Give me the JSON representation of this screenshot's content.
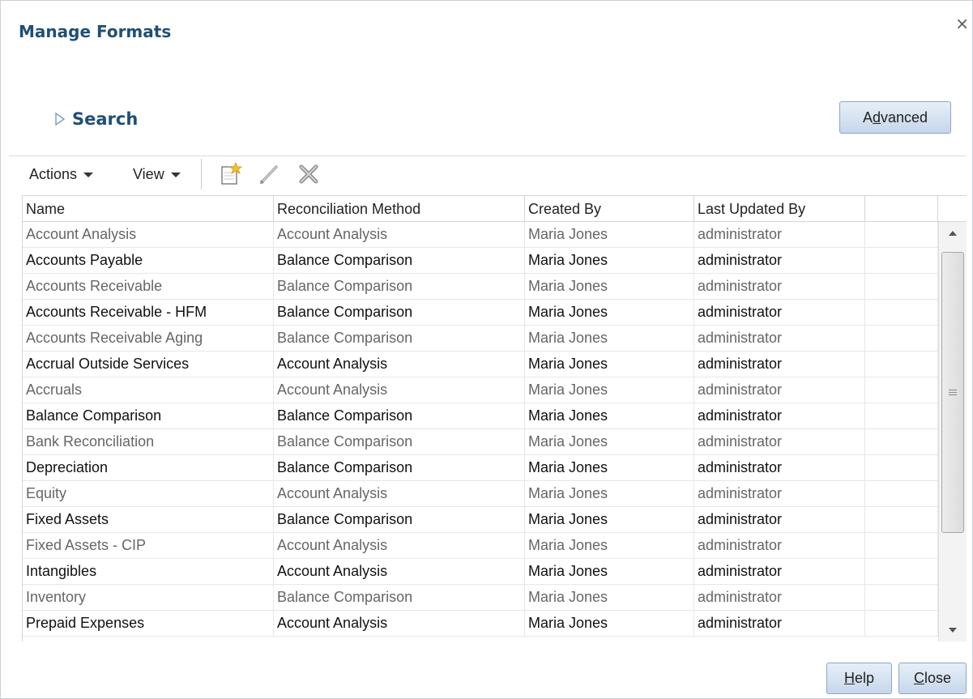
{
  "dialog": {
    "title": "Manage Formats",
    "close_glyph": "×"
  },
  "search": {
    "label": "Search",
    "advanced_pre": "A",
    "advanced_ul": "d",
    "advanced_post": "vanced"
  },
  "toolbar": {
    "actions_label": "Actions",
    "view_label": "View",
    "icons": [
      "new-icon",
      "edit-icon",
      "delete-icon"
    ]
  },
  "table": {
    "columns": [
      "Name",
      "Reconciliation Method",
      "Created By",
      "Last Updated By"
    ],
    "rows": [
      [
        "Account Analysis",
        "Account Analysis",
        "Maria Jones",
        "administrator"
      ],
      [
        "Accounts Payable",
        "Balance Comparison",
        "Maria Jones",
        "administrator"
      ],
      [
        "Accounts Receivable",
        "Balance Comparison",
        "Maria Jones",
        "administrator"
      ],
      [
        "Accounts Receivable - HFM",
        "Balance Comparison",
        "Maria Jones",
        "administrator"
      ],
      [
        "Accounts Receivable Aging",
        "Balance Comparison",
        "Maria Jones",
        "administrator"
      ],
      [
        "Accrual Outside Services",
        "Account Analysis",
        "Maria Jones",
        "administrator"
      ],
      [
        "Accruals",
        "Account Analysis",
        "Maria Jones",
        "administrator"
      ],
      [
        "Balance Comparison",
        "Balance Comparison",
        "Maria Jones",
        "administrator"
      ],
      [
        "Bank Reconciliation",
        "Balance Comparison",
        "Maria Jones",
        "administrator"
      ],
      [
        "Depreciation",
        "Balance Comparison",
        "Maria Jones",
        "administrator"
      ],
      [
        "Equity",
        "Account Analysis",
        "Maria Jones",
        "administrator"
      ],
      [
        "Fixed Assets",
        "Balance Comparison",
        "Maria Jones",
        "administrator"
      ],
      [
        "Fixed Assets - CIP",
        "Account Analysis",
        "Maria Jones",
        "administrator"
      ],
      [
        "Intangibles",
        "Account Analysis",
        "Maria Jones",
        "administrator"
      ],
      [
        "Inventory",
        "Balance Comparison",
        "Maria Jones",
        "administrator"
      ],
      [
        "Prepaid Expenses",
        "Account Analysis",
        "Maria Jones",
        "administrator"
      ]
    ]
  },
  "footer": {
    "help_ul": "H",
    "help_post": "elp",
    "close_ul": "C",
    "close_post": "lose"
  },
  "colors": {
    "title": "#1f4f77",
    "button_top": "#e6eff8",
    "button_bottom": "#c6d7ea"
  }
}
